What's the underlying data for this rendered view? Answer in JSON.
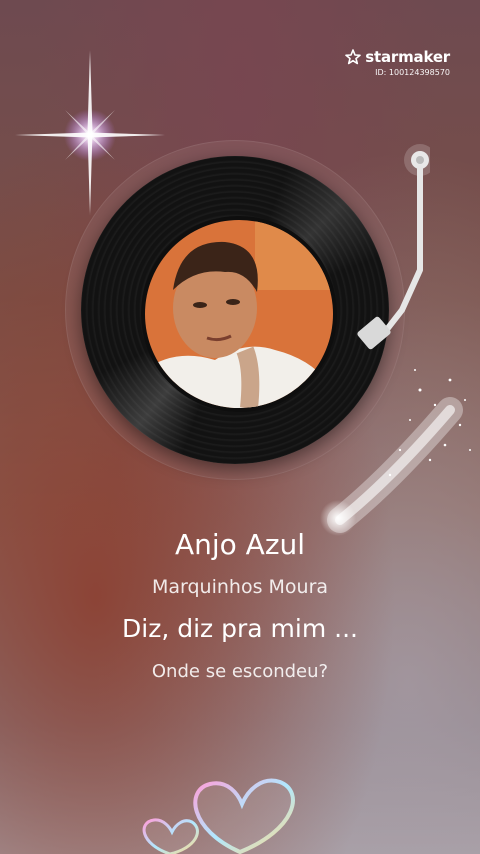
{
  "brand": {
    "name": "starmaker",
    "id_text": "ID: 100124398570"
  },
  "player": {
    "icons": [
      "star-logo-icon",
      "sparkle-icon",
      "vinyl-record-icon",
      "tonearm-icon",
      "glitter-spray-icon",
      "hearts-icon"
    ]
  },
  "song": {
    "title": "Anjo Azul",
    "artist": "Marquinhos Moura"
  },
  "lyrics": {
    "current": "Diz, diz pra mim ...",
    "next": "Onde se escondeu?"
  },
  "colors": {
    "text": "#ffffff",
    "record": "#121212",
    "cover_bg": "#d9733a"
  }
}
